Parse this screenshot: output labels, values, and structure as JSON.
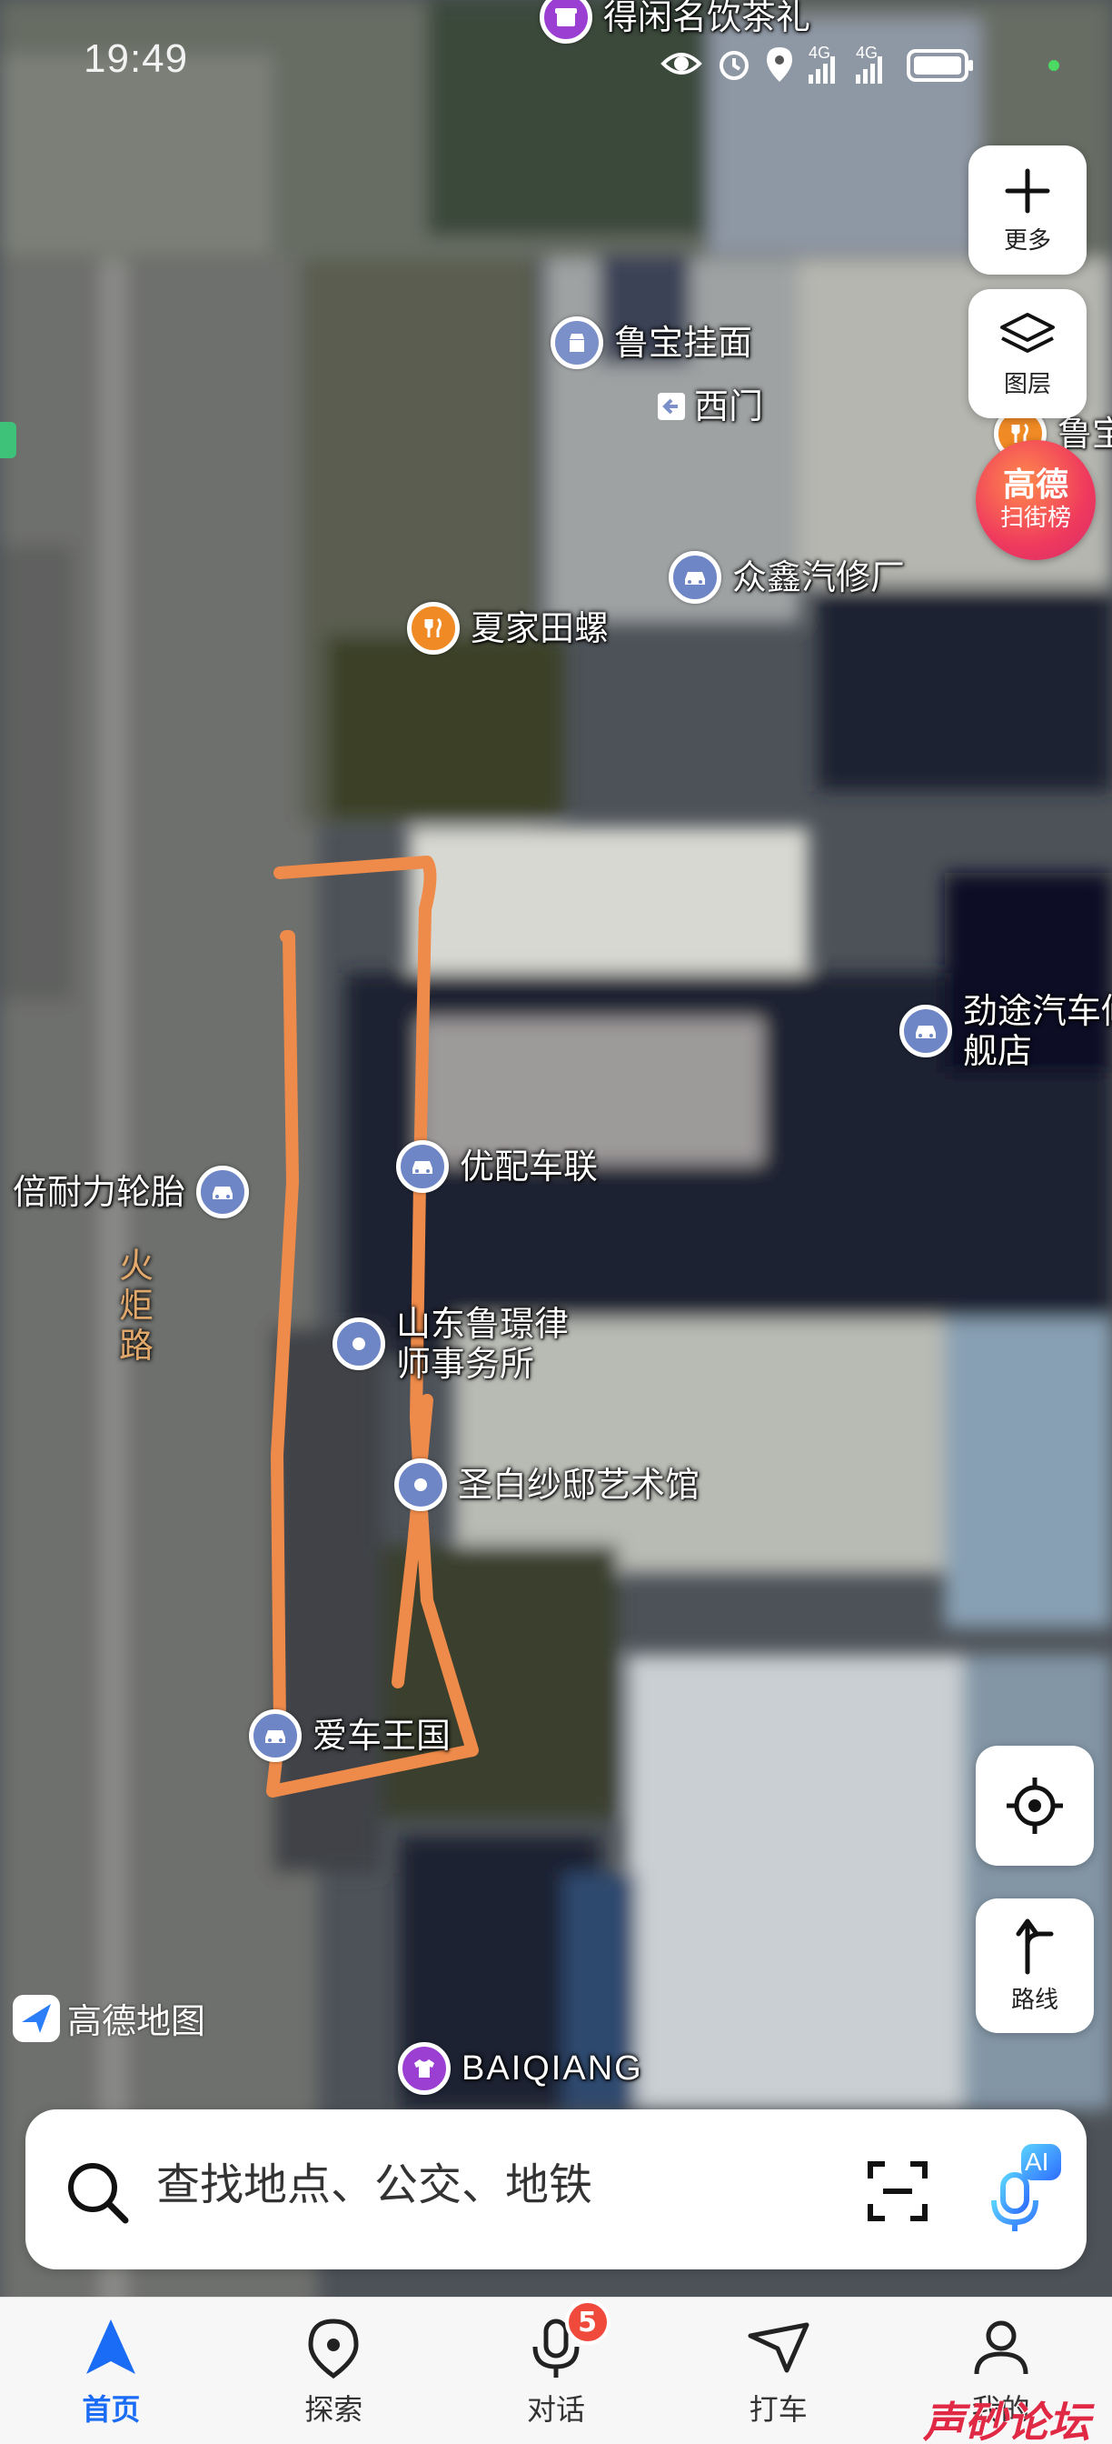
{
  "status_bar": {
    "time": "19:49",
    "network_1": "4G",
    "network_2": "4G"
  },
  "map": {
    "road_label": "火炬路",
    "pois": [
      {
        "id": "dexian",
        "name": "得闲名饮茶礼",
        "icon": "tea-shop-icon",
        "color": "#9b3fd3"
      },
      {
        "id": "lubao",
        "name": "鲁宝挂面",
        "icon": "shop-icon",
        "color": "#7b8fc8"
      },
      {
        "id": "ximen",
        "name": "西门",
        "icon": "gate-icon",
        "color": "#ffffff"
      },
      {
        "id": "zhongxin",
        "name": "众鑫汽修厂",
        "icon": "car-icon",
        "color": "#6f86c6"
      },
      {
        "id": "xiajia",
        "name": "夏家田螺",
        "icon": "restaurant-icon",
        "color": "#f08a24"
      },
      {
        "id": "lu_partial",
        "name": "鲁宝",
        "icon": "restaurant-icon",
        "color": "#f08a24"
      },
      {
        "id": "jintu",
        "name": "劲途汽车修旗舰店",
        "icon": "car-icon",
        "color": "#6f86c6"
      },
      {
        "id": "beinaili",
        "name": "倍耐力轮胎",
        "icon": "car-icon",
        "color": "#6f86c6"
      },
      {
        "id": "youpei",
        "name": "优配车联",
        "icon": "car-icon",
        "color": "#6f86c6"
      },
      {
        "id": "lawfirm",
        "name": "山东鲁璟律师事务所",
        "icon": "place-icon",
        "color": "#6f86c6"
      },
      {
        "id": "shengbai",
        "name": "圣白纱邸艺术馆",
        "icon": "place-icon",
        "color": "#6f86c6"
      },
      {
        "id": "aiche",
        "name": "爱车王国",
        "icon": "car-icon",
        "color": "#6f86c6"
      },
      {
        "id": "baiqiang",
        "name": "BAIQIANG",
        "icon": "clothing-icon",
        "color": "#9b3fd3"
      }
    ],
    "annotation_color": "#ee8a4a",
    "logo_text": "高德地图"
  },
  "controls": {
    "more_label": "更多",
    "layers_label": "图层",
    "rank_title": "高德",
    "rank_subtitle": "扫街榜",
    "route_label": "路线"
  },
  "search": {
    "placeholder": "查找地点、公交、地铁",
    "ai_label": "AI"
  },
  "bottom_nav": {
    "items": [
      {
        "label": "首页",
        "icon": "home-navigation-icon",
        "active": true
      },
      {
        "label": "探索",
        "icon": "location-pin-icon"
      },
      {
        "label": "对话",
        "icon": "microphone-icon",
        "badge": "5"
      },
      {
        "label": "打车",
        "icon": "taxi-icon"
      },
      {
        "label": "我的",
        "icon": "profile-icon"
      }
    ]
  },
  "watermark": "声砂论坛",
  "colors": {
    "accent": "#1a6cf6",
    "badge": "#f04a3c"
  }
}
